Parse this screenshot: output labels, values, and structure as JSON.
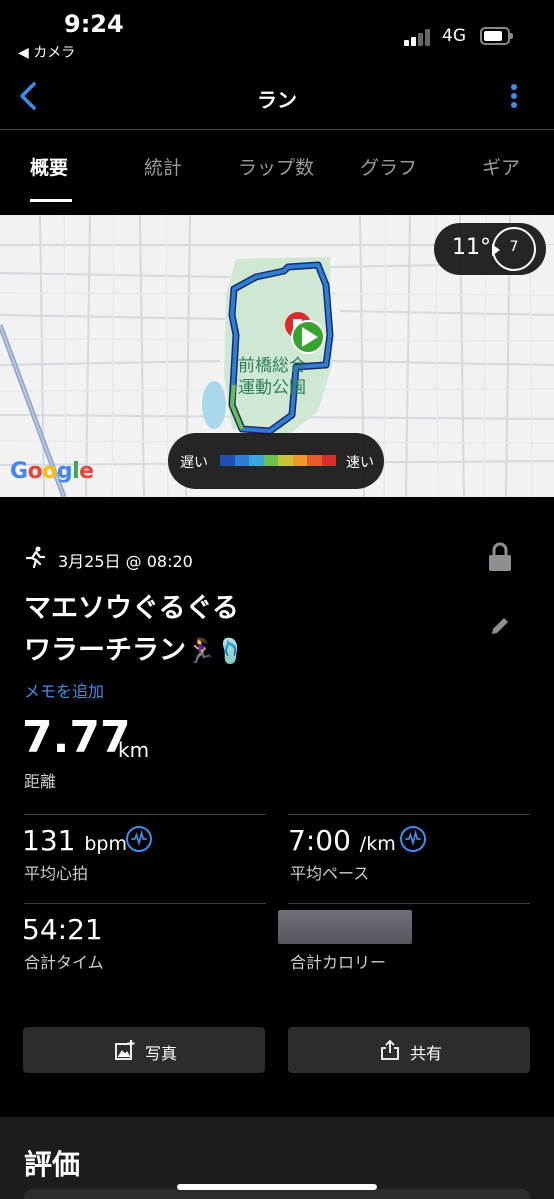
{
  "status_bar": {
    "time": "9:24",
    "back_app": "◀ カメラ",
    "network": "4G"
  },
  "nav": {
    "title": "ラン"
  },
  "tabs": [
    {
      "label": "概要",
      "active": true
    },
    {
      "label": "統計",
      "active": false
    },
    {
      "label": "ラップ数",
      "active": false
    },
    {
      "label": "グラフ",
      "active": false
    },
    {
      "label": "ギア",
      "active": false
    }
  ],
  "map": {
    "temperature": "11°",
    "wind": "7",
    "place_name_line1": "前橋総合",
    "place_name_line2": "運動公園",
    "speed_slow": "遅い",
    "speed_fast": "速い",
    "speed_colors": [
      "#1f4fb8",
      "#2d7fd6",
      "#39a8e0",
      "#6bbf4b",
      "#c9c33a",
      "#f09a2a",
      "#e8592b",
      "#d62f2f"
    ],
    "attribution": "Google"
  },
  "activity": {
    "datetime": "3月25日 @ 08:20",
    "title_line1": "マエソウぐるぐる",
    "title_line2": "ワラーチラン",
    "title_emoji": "🏃‍♀️🩴",
    "add_memo": "メモを追加"
  },
  "stats": {
    "distance": {
      "value": "7.77",
      "unit": "km",
      "label": "距離"
    },
    "avg_hr": {
      "value": "131",
      "unit": "bpm",
      "label": "平均心拍"
    },
    "avg_pace": {
      "value": "7:00",
      "unit": "/km",
      "label": "平均ペース"
    },
    "total_time": {
      "value": "54:21",
      "label": "合計タイム"
    },
    "total_calories": {
      "label": "合計カロリー"
    }
  },
  "actions": {
    "photo": "写真",
    "share": "共有"
  },
  "rating": {
    "title": "評価"
  }
}
